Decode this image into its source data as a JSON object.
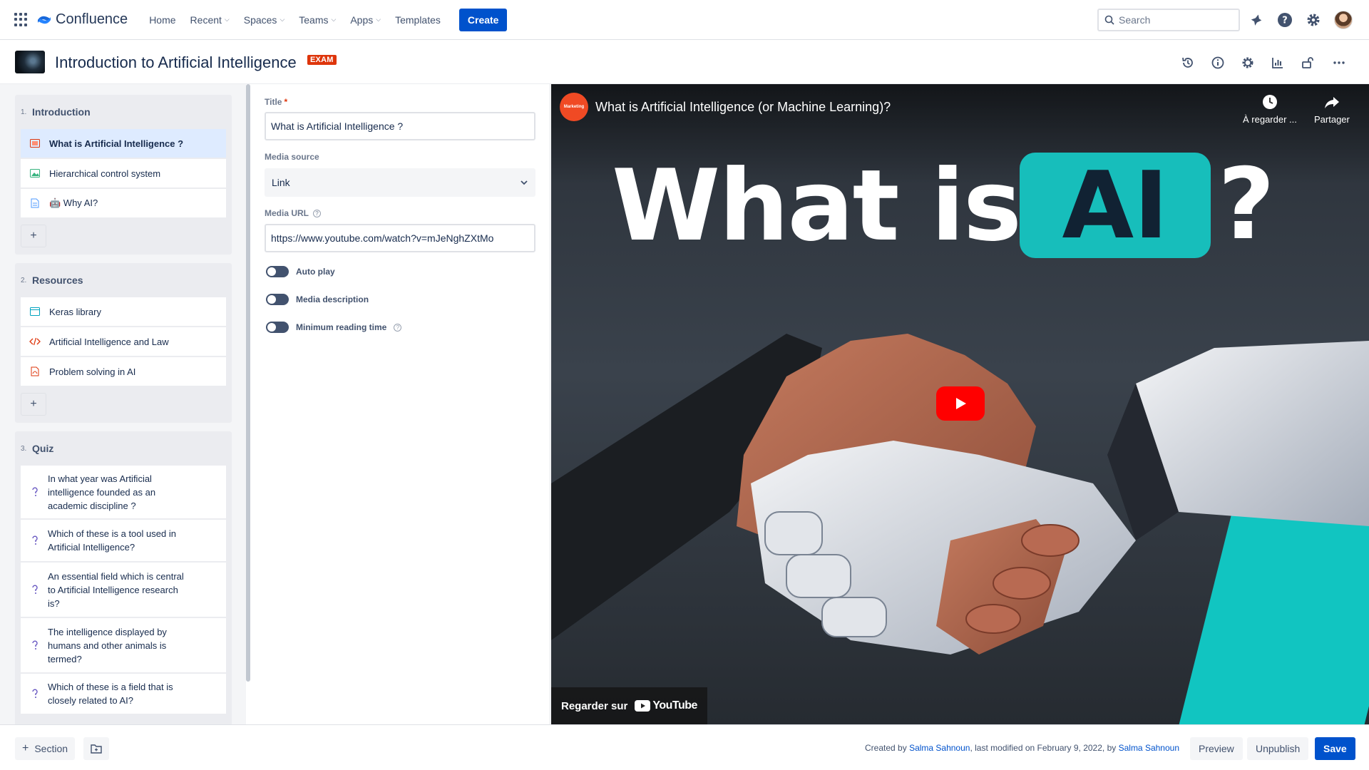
{
  "topnav": {
    "logo_text": "Confluence",
    "items": [
      {
        "label": "Home",
        "has_dropdown": false
      },
      {
        "label": "Recent",
        "has_dropdown": true
      },
      {
        "label": "Spaces",
        "has_dropdown": true
      },
      {
        "label": "Teams",
        "has_dropdown": true
      },
      {
        "label": "Apps",
        "has_dropdown": true
      },
      {
        "label": "Templates",
        "has_dropdown": false
      }
    ],
    "create_label": "Create",
    "search_placeholder": "Search",
    "icons": [
      "notifications-icon",
      "help-icon",
      "settings-icon"
    ]
  },
  "page": {
    "title": "Introduction to Artificial Intelligence",
    "badge": "EXAM",
    "header_icons": [
      "history-icon",
      "info-icon",
      "settings-icon",
      "analytics-icon",
      "unlock-icon",
      "more-icon"
    ]
  },
  "sidebar": {
    "sections": [
      {
        "number": "1.",
        "title": "Introduction",
        "items": [
          {
            "label": "What is Artificial Intelligence ?",
            "icon": "video-icon",
            "active": true
          },
          {
            "label": "Hierarchical control system",
            "icon": "image-icon",
            "active": false
          },
          {
            "label": "🤖 Why AI?",
            "icon": "page-icon",
            "active": false
          }
        ],
        "add_label": "+"
      },
      {
        "number": "2.",
        "title": "Resources",
        "items": [
          {
            "label": "Keras library",
            "icon": "web-icon"
          },
          {
            "label": "Artificial Intelligence and Law",
            "icon": "code-icon"
          },
          {
            "label": "Problem solving in AI",
            "icon": "pdf-icon"
          }
        ],
        "add_label": "+"
      },
      {
        "number": "3.",
        "title": "Quiz",
        "items": [
          {
            "label": "In what year was Artificial intelligence founded as an academic discipline ?",
            "icon": "quiz-icon"
          },
          {
            "label": "Which of these is a tool used in Artificial Intelligence?",
            "icon": "quiz-icon"
          },
          {
            "label": "An essential field which is central to Artificial Intelligence research is?",
            "icon": "quiz-icon"
          },
          {
            "label": "The intelligence displayed by humans and other animals is termed?",
            "icon": "quiz-icon"
          },
          {
            "label": "Which of these is a field that is closely related to AI?",
            "icon": "quiz-icon"
          }
        ]
      }
    ]
  },
  "form": {
    "title_label": "Title",
    "title_required": "*",
    "title_value": "What is Artificial Intelligence ?",
    "media_source_label": "Media source",
    "media_source_value": "Link",
    "media_url_label": "Media URL",
    "media_url_value": "https://www.youtube.com/watch?v=mJeNghZXtMo",
    "toggles": [
      {
        "label": "Auto play",
        "on": false,
        "help": false
      },
      {
        "label": "Media description",
        "on": false,
        "help": false
      },
      {
        "label": "Minimum reading time",
        "on": false,
        "help": true
      }
    ]
  },
  "video": {
    "channel_logo_text": "Marketing",
    "title": "What is Artificial Intelligence (or Machine Learning)?",
    "watch_later_label": "À regarder ...",
    "share_label": "Partager",
    "hero_what_is": "What is",
    "hero_ai": "AI",
    "hero_q": "?",
    "watch_on_label": "Regarder sur",
    "youtube_label": "YouTube",
    "accent_color": "#17bebb"
  },
  "bottom": {
    "section_label": "Section",
    "meta_created_by": "Created by ",
    "meta_author": "Salma Sahnoun",
    "meta_modified": ", last modified on February 9, 2022, by ",
    "meta_modifier": "Salma Sahnoun",
    "preview_label": "Preview",
    "unpublish_label": "Unpublish",
    "save_label": "Save"
  },
  "colors": {
    "brand_blue": "#0052cc",
    "exam_red": "#de350b",
    "active_item": "#deebff"
  }
}
